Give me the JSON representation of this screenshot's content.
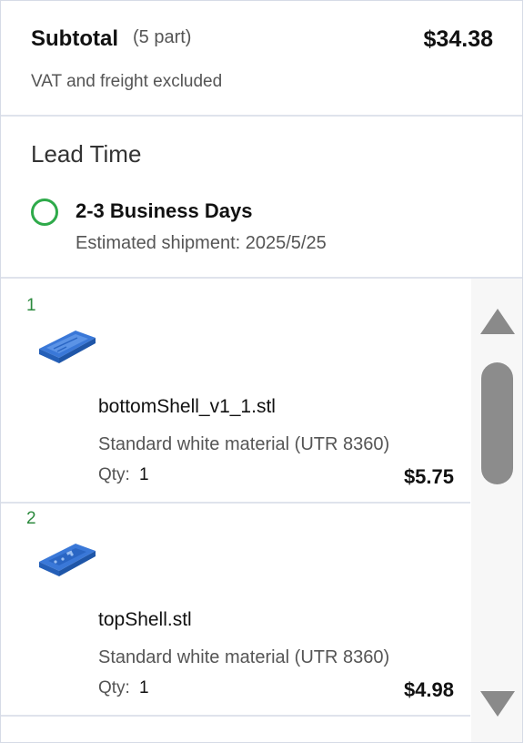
{
  "subtotal": {
    "title": "Subtotal",
    "count": "(5 part)",
    "amount": "$34.38",
    "note": "VAT and freight excluded"
  },
  "lead_time": {
    "title": "Lead Time",
    "option": "2-3 Business Days",
    "shipment": "Estimated shipment: 2025/5/25"
  },
  "parts": [
    {
      "index": "1",
      "name": "bottomShell_v1_1.stl",
      "material": "Standard white material (UTR 8360)",
      "qty_label": "Qty:",
      "qty": "1",
      "price": "$5.75"
    },
    {
      "index": "2",
      "name": "topShell.stl",
      "material": "Standard white material (UTR 8360)",
      "qty_label": "Qty:",
      "qty": "1",
      "price": "$4.98"
    }
  ],
  "colors": {
    "accent_green": "#2eaa4a",
    "index_green": "#2c8a3e",
    "model_blue": "#2f6fd1",
    "scrollbar": "#8c8c8c"
  },
  "icons": {
    "radio": "radio-unselected-icon",
    "thumb": "3d-model-thumbnail",
    "scroll_up": "triangle-up-icon",
    "scroll_down": "triangle-down-icon"
  }
}
